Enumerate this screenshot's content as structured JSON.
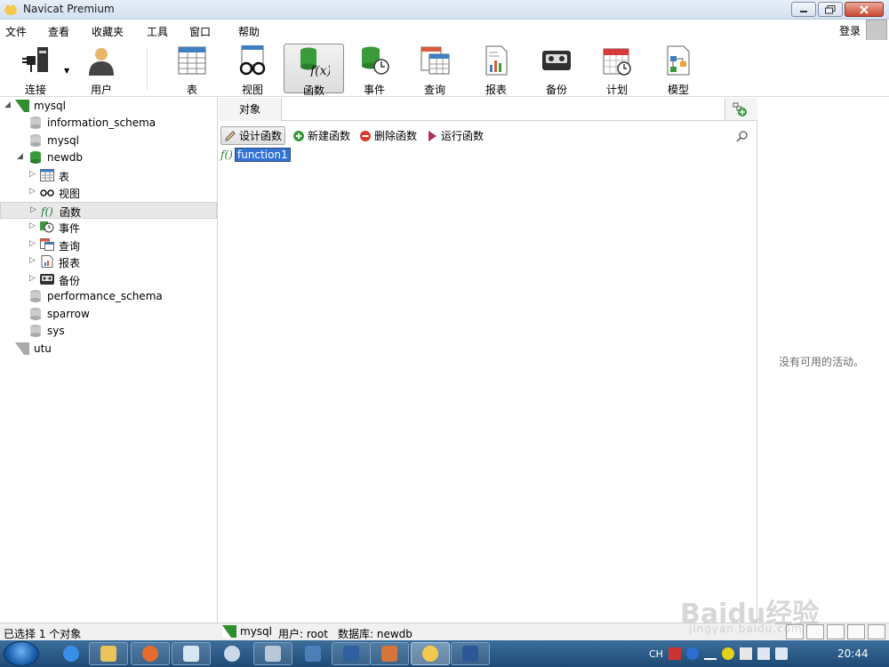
{
  "window": {
    "title": "Navicat Premium"
  },
  "menu": {
    "items": [
      "文件",
      "查看",
      "收藏夹",
      "工具",
      "窗口",
      "帮助"
    ],
    "login": "登录"
  },
  "toolbar": {
    "items": [
      {
        "label": "连接",
        "icon": "plug-icon"
      },
      {
        "label": "用户",
        "icon": "user-icon"
      },
      {
        "label": "表",
        "icon": "table-icon"
      },
      {
        "label": "视图",
        "icon": "glasses-icon"
      },
      {
        "label": "函数",
        "icon": "function-icon",
        "active": true
      },
      {
        "label": "事件",
        "icon": "event-icon"
      },
      {
        "label": "查询",
        "icon": "query-icon"
      },
      {
        "label": "报表",
        "icon": "report-icon"
      },
      {
        "label": "备份",
        "icon": "backup-icon"
      },
      {
        "label": "计划",
        "icon": "calendar-icon"
      },
      {
        "label": "模型",
        "icon": "model-icon"
      }
    ]
  },
  "tree": {
    "nodes": [
      {
        "label": "mysql",
        "type": "connection",
        "expanded": true
      },
      {
        "label": "information_schema",
        "type": "database"
      },
      {
        "label": "mysql",
        "type": "database"
      },
      {
        "label": "newdb",
        "type": "database",
        "expanded": true
      },
      {
        "label": "表",
        "type": "table-group"
      },
      {
        "label": "视图",
        "type": "view-group"
      },
      {
        "label": "函数",
        "type": "function-group",
        "selected": true
      },
      {
        "label": "事件",
        "type": "event-group"
      },
      {
        "label": "查询",
        "type": "query-group"
      },
      {
        "label": "报表",
        "type": "report-group"
      },
      {
        "label": "备份",
        "type": "backup-group"
      },
      {
        "label": "performance_schema",
        "type": "database"
      },
      {
        "label": "sparrow",
        "type": "database"
      },
      {
        "label": "sys",
        "type": "database"
      },
      {
        "label": "utu",
        "type": "connection"
      }
    ]
  },
  "center": {
    "tab_label": "对象",
    "actions": [
      "设计函数",
      "新建函数",
      "删除函数",
      "运行函数"
    ],
    "objects": [
      {
        "name": "function1",
        "icon_text": "f()"
      }
    ]
  },
  "right": {
    "empty_text": "没有可用的活动。"
  },
  "status": {
    "selection": "已选择 1 个对象",
    "connection": "mysql",
    "user": "用户: root",
    "database": "数据库: newdb"
  },
  "taskbar": {
    "time": "20:44",
    "lang": "CH"
  },
  "watermark": {
    "line1": "Baidu经验",
    "line2": "jingyan.baidu.com"
  },
  "colors": {
    "selection_blue": "#3373d6",
    "db_green": "#3a9b3a",
    "taskbar": "#2a5985"
  }
}
